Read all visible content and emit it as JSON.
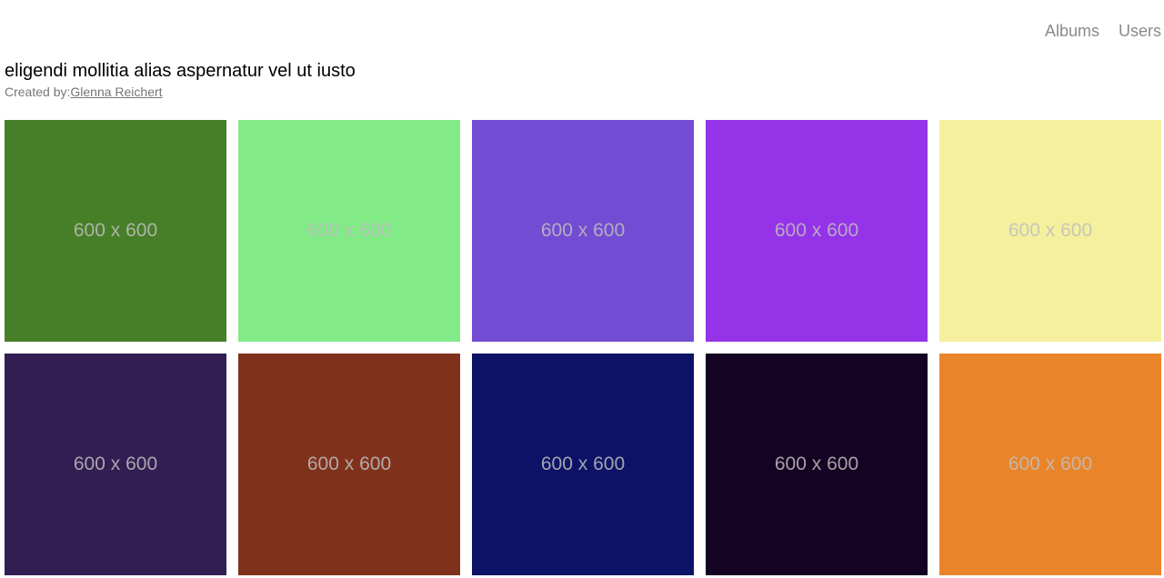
{
  "nav": {
    "albums_label": "Albums",
    "users_label": "Users"
  },
  "album": {
    "title": "eligendi mollitia alias aspernatur vel ut iusto",
    "created_by_label": "Created by:",
    "creator_name": "Glenna Reichert"
  },
  "photos": [
    {
      "label": "600 x 600",
      "color": "#477e28"
    },
    {
      "label": "600 x 600",
      "color": "#82eb88"
    },
    {
      "label": "600 x 600",
      "color": "#724cd2"
    },
    {
      "label": "600 x 600",
      "color": "#9533e8"
    },
    {
      "label": "600 x 600",
      "color": "#f5f09e"
    },
    {
      "label": "600 x 600",
      "color": "#321e52"
    },
    {
      "label": "600 x 600",
      "color": "#80311c"
    },
    {
      "label": "600 x 600",
      "color": "#0c1266"
    },
    {
      "label": "600 x 600",
      "color": "#150323"
    },
    {
      "label": "600 x 600",
      "color": "#ea842a"
    }
  ]
}
